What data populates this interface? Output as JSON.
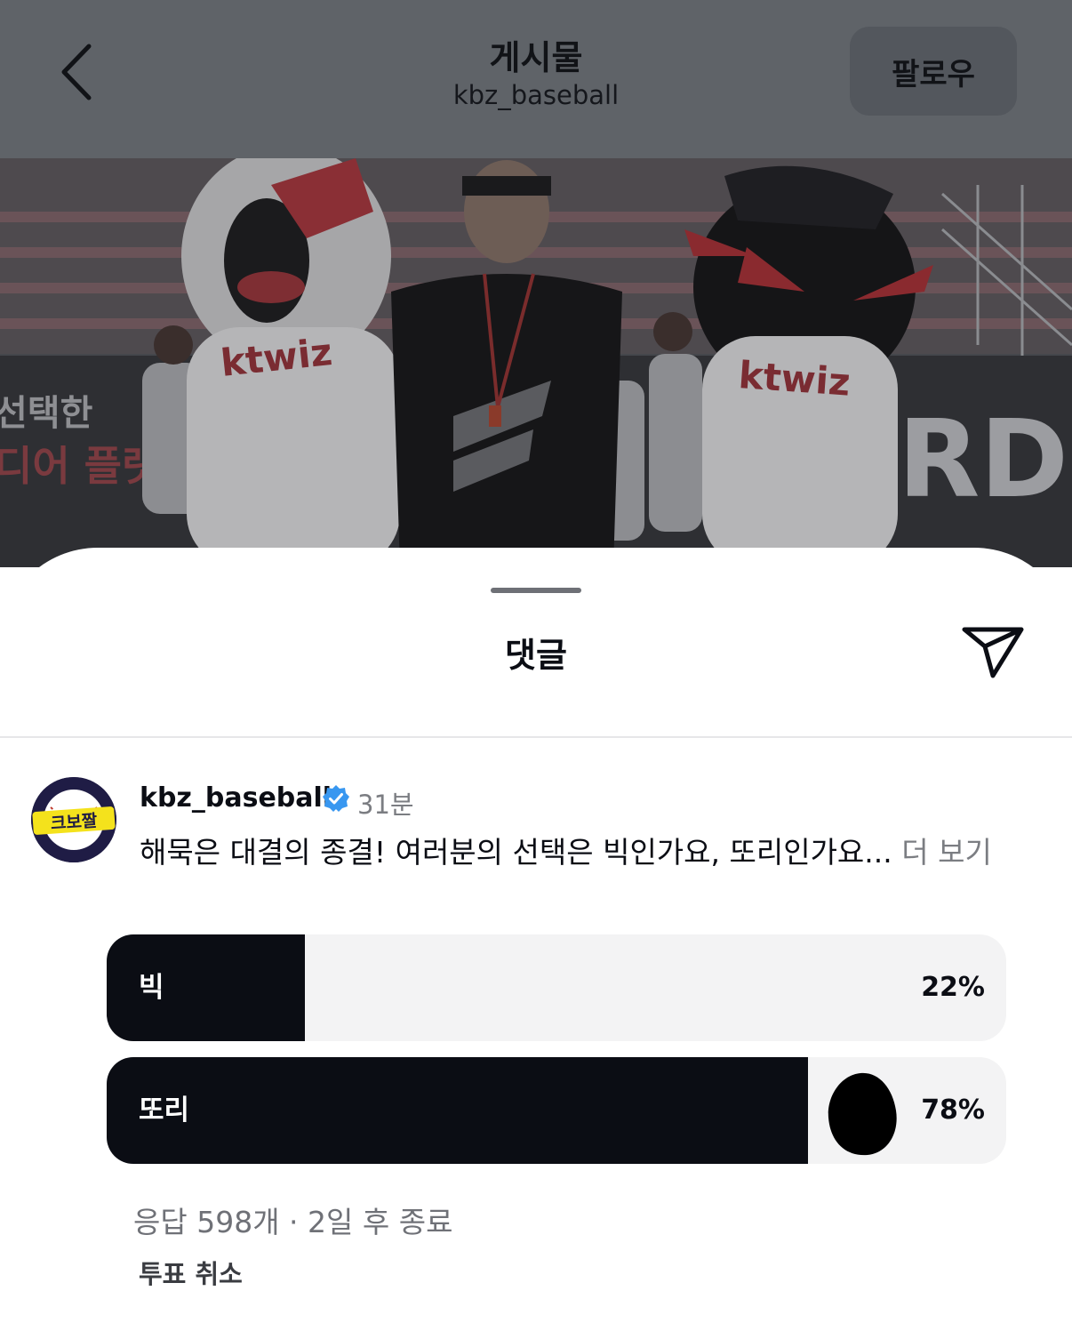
{
  "header": {
    "title": "게시물",
    "username": "kbz_baseball",
    "follow_label": "팔로우"
  },
  "photo": {
    "sign_left_1": "선택한",
    "sign_left_2": "디어 플랫",
    "sign_right": "RD.",
    "jersey_text": "ktwiz"
  },
  "sheet": {
    "title": "댓글"
  },
  "post": {
    "username": "kbz_baseball",
    "time": "31분",
    "caption": "해묵은 대결의 종결! 여러분의 선택은 빅인가요, 또리인가요...",
    "more_label": "더 보기",
    "avatar_text": "크보짤"
  },
  "poll": {
    "options": [
      {
        "label": "빅",
        "percent": 22,
        "percent_text": "22%"
      },
      {
        "label": "또리",
        "percent": 78,
        "percent_text": "78%"
      }
    ],
    "meta": "응답 598개 · 2일 후 종료",
    "cancel_label": "투표 취소"
  },
  "colors": {
    "accent_dark": "#0b0d14",
    "verified_blue": "#3897f0",
    "overlay": "#5f6368"
  }
}
